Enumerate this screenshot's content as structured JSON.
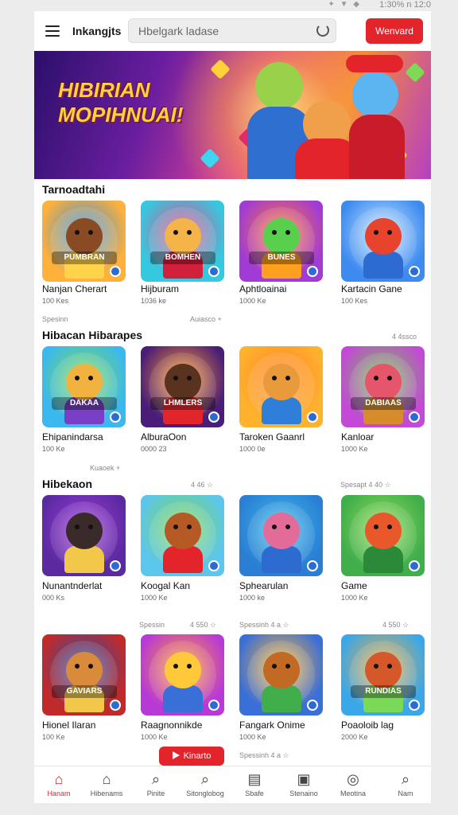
{
  "status": {
    "time": "1:30% n 12:0",
    "icons": "✦ ▼ ◆"
  },
  "header": {
    "title": "Inkangjts",
    "search_value": "Hbelgark ladase",
    "primary_button": "Wenvard"
  },
  "banner": {
    "title_line1": "HIBIRIAN",
    "title_line2": "MOPIHNUAI!"
  },
  "sections": [
    {
      "title": "Tarnoadtahi",
      "meta_left": "Spesinn",
      "meta_right": "Auiasco +"
    },
    {
      "title": "Hibacan Hibarapes",
      "meta_right": "4 4ssco",
      "meta_left": "Kuaoek +"
    },
    {
      "title": "Hibekaon",
      "meta_mid": "4 46 ☆",
      "meta_right": "Spesapt   4 40 ☆"
    },
    {
      "meta_left": "Spessin",
      "meta_mid": "4 550 ☆",
      "meta_right": "Spessinh   4 a ☆",
      "meta_far": "4 550 ☆"
    }
  ],
  "games": [
    {
      "name": "Nanjan Cherart",
      "sub": "100 Kes",
      "tag": "PUMBRAN",
      "colors": [
        "#ffb13b",
        "#3a8fd9",
        "#8a4a24",
        "#ffd34a"
      ]
    },
    {
      "name": "Hijburam",
      "sub": "1036 ke",
      "tag": "BOMHEN",
      "colors": [
        "#35c9e0",
        "#e54b8a",
        "#f4b44a",
        "#d2203c"
      ]
    },
    {
      "name": "Aphtloainai",
      "sub": "1000 Ke",
      "tag": "BUNES",
      "colors": [
        "#a13bd6",
        "#ff7a2e",
        "#58d04d",
        "#ff9f1e"
      ]
    },
    {
      "name": "Kartacin Gane",
      "sub": "100 Kes",
      "tag": "",
      "colors": [
        "#3e8bf0",
        "#c6e6ff",
        "#e8432c",
        "#2d6bd1"
      ]
    },
    {
      "name": "Ehipanindarsa",
      "sub": "100 Ke",
      "tag": "DAKAA",
      "colors": [
        "#3ab8ef",
        "#7ed955",
        "#f1b23f",
        "#7a3fc6"
      ]
    },
    {
      "name": "AlburaOon",
      "sub": "0000 23",
      "tag": "LHMLERS",
      "colors": [
        "#4a1d78",
        "#ff9a2a",
        "#5a3320",
        "#e3242b"
      ]
    },
    {
      "name": "Taroken Gaanrl",
      "sub": "1000 0e",
      "tag": "",
      "colors": [
        "#ffb22e",
        "#ff7f24",
        "#e99a3a",
        "#2f7ed8"
      ]
    },
    {
      "name": "Kanloar",
      "sub": "1000 Ke",
      "tag": "DABIAAS",
      "colors": [
        "#c24ad6",
        "#71c34a",
        "#e6566a",
        "#d88b2a"
      ]
    },
    {
      "name": "Nunantnderlat",
      "sub": "000 Ks",
      "tag": "",
      "colors": [
        "#5b2aa0",
        "#9e3bd8",
        "#3a2a2a",
        "#f2c84a"
      ]
    },
    {
      "name": "Koogal Kan",
      "sub": "1000 Ke",
      "tag": "",
      "colors": [
        "#5cc6ec",
        "#7fd64f",
        "#b55a24",
        "#e3242b"
      ]
    },
    {
      "name": "Sphearulan",
      "sub": "1000 ke",
      "tag": "",
      "colors": [
        "#2a7fd4",
        "#3fb8e8",
        "#e36b9a",
        "#2d6bd1"
      ]
    },
    {
      "name": "Game",
      "sub": "1000 Ke",
      "tag": "",
      "colors": [
        "#3fae4b",
        "#8fd95a",
        "#e8582a",
        "#2a8a3a"
      ]
    },
    {
      "name": "Hionel Ilaran",
      "sub": "100 Ke",
      "tag": "GAVIARS",
      "colors": [
        "#c12a2a",
        "#2a4fa8",
        "#d98a3a",
        "#f2c84a"
      ]
    },
    {
      "name": "Raagnonnikde",
      "sub": "1000 Ke",
      "tag": "",
      "colors": [
        "#b83ad6",
        "#ff9a2a",
        "#ffc93a",
        "#3a6fd8"
      ]
    },
    {
      "name": "Fangark Onime",
      "sub": "1000 Ke",
      "tag": "",
      "colors": [
        "#3a6fd8",
        "#ffb82e",
        "#c26a24",
        "#3fae4b"
      ]
    },
    {
      "name": "Poaoloib lag",
      "sub": "2000 Ke",
      "tag": "RUNDIAS",
      "colors": [
        "#3aa8e8",
        "#f2a83a",
        "#d4582a",
        "#7ad955"
      ]
    }
  ],
  "floating_button": {
    "label": "Kinarto"
  },
  "nav": [
    {
      "label": "Hanam",
      "icon": "home-icon",
      "active": true
    },
    {
      "label": "Hibenams",
      "icon": "house-outline-icon"
    },
    {
      "label": "Pinite",
      "icon": "search-icon"
    },
    {
      "label": "Sitonglobog",
      "icon": "search-icon"
    },
    {
      "label": "Sbafe",
      "icon": "document-icon"
    },
    {
      "label": "Stenaino",
      "icon": "wallet-icon"
    },
    {
      "label": "Meotina",
      "icon": "gamepad-icon"
    },
    {
      "label": "Nam",
      "icon": "search-icon"
    }
  ]
}
